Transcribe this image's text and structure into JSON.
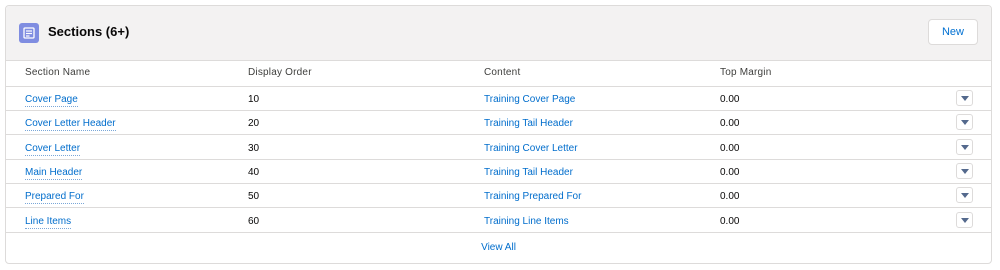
{
  "card": {
    "title": "Sections (6+)",
    "new_label": "New",
    "icon": "section-list-icon",
    "icon_color": "#7f8de1"
  },
  "columns": [
    "Section Name",
    "Display Order",
    "Content",
    "Top Margin"
  ],
  "rows": [
    {
      "name": "Cover Page",
      "order": "10",
      "content": "Training Cover Page",
      "margin": "0.00"
    },
    {
      "name": "Cover Letter Header",
      "order": "20",
      "content": "Training Tail Header",
      "margin": "0.00"
    },
    {
      "name": "Cover Letter",
      "order": "30",
      "content": "Training Cover Letter",
      "margin": "0.00"
    },
    {
      "name": "Main Header",
      "order": "40",
      "content": "Training Tail Header",
      "margin": "0.00"
    },
    {
      "name": "Prepared For",
      "order": "50",
      "content": "Training Prepared For",
      "margin": "0.00"
    },
    {
      "name": "Line Items",
      "order": "60",
      "content": "Training Line Items",
      "margin": "0.00"
    }
  ],
  "footer": {
    "view_all": "View All"
  },
  "colors": {
    "link": "#006dcc",
    "border": "#dddbda",
    "header_bg": "#f3f2f2"
  }
}
